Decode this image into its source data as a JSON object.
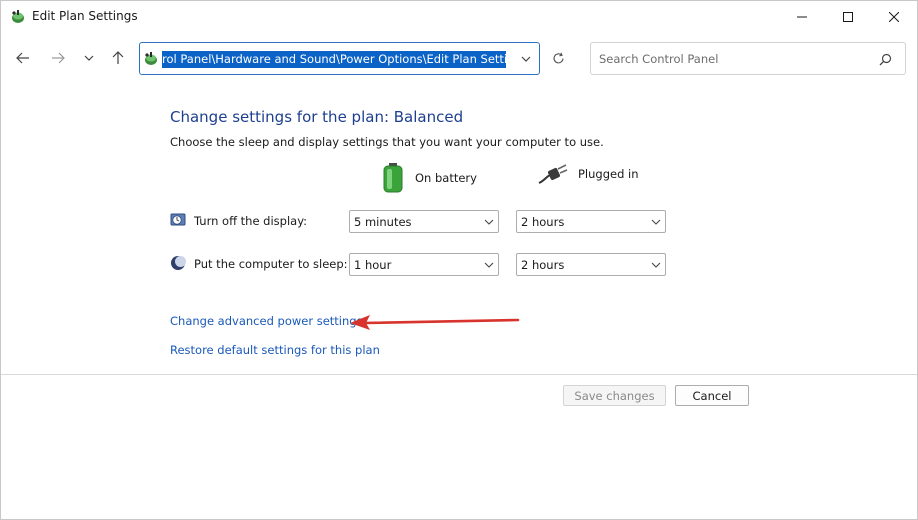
{
  "window": {
    "title": "Edit Plan Settings"
  },
  "nav": {
    "address_path": "rol Panel\\Hardware and Sound\\Power Options\\Edit Plan Settings",
    "search_placeholder": "Search Control Panel"
  },
  "main": {
    "heading": "Change settings for the plan: Balanced",
    "subheading": "Choose the sleep and display settings that you want your computer to use.",
    "columns": {
      "battery": "On battery",
      "plugged": "Plugged in"
    },
    "rows": [
      {
        "label": "Turn off the display:",
        "battery_value": "5 minutes",
        "plugged_value": "2 hours"
      },
      {
        "label": "Put the computer to sleep:",
        "battery_value": "1 hour",
        "plugged_value": "2 hours"
      }
    ],
    "links": {
      "advanced": "Change advanced power settings",
      "restore": "Restore default settings for this plan"
    }
  },
  "footer": {
    "save_label": "Save changes",
    "cancel_label": "Cancel"
  },
  "colors": {
    "accent": "#0b62c7",
    "heading": "#1e3f8f",
    "link": "#1a59b8",
    "annotation_arrow": "#d8332c"
  },
  "icons": {
    "app": "power-options-icon",
    "battery": "battery-icon",
    "plug": "plug-icon",
    "display": "display-timer-icon",
    "sleep": "moon-sleep-icon"
  }
}
